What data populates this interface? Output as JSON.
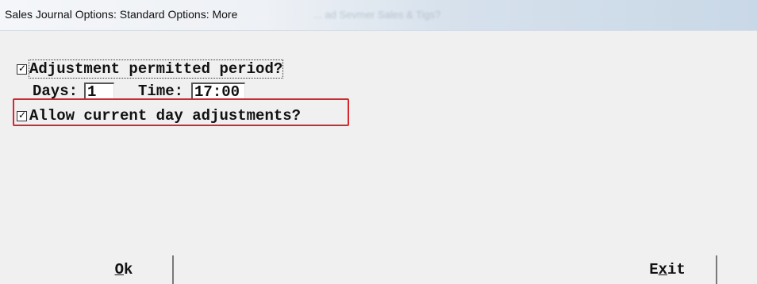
{
  "window": {
    "title": "Sales Journal Options:  Standard Options: More",
    "ghost_title": "... ad Sevmer Sales & Tigs?"
  },
  "options": {
    "adjustment_period": {
      "label": "Adjustment permitted period?",
      "checked": true
    },
    "days": {
      "label": "Days:",
      "value": "1"
    },
    "time": {
      "label": "Time:",
      "value": "17:00"
    },
    "allow_current_day": {
      "label": "Allow current day adjustments?",
      "checked": true
    }
  },
  "buttons": {
    "ok": {
      "mnemonic": "O",
      "rest": "k"
    },
    "exit": {
      "pre": "E",
      "mnemonic": "x",
      "rest": "it"
    }
  },
  "colors": {
    "highlight": "#d9262c",
    "face": "#f0f0f0"
  }
}
